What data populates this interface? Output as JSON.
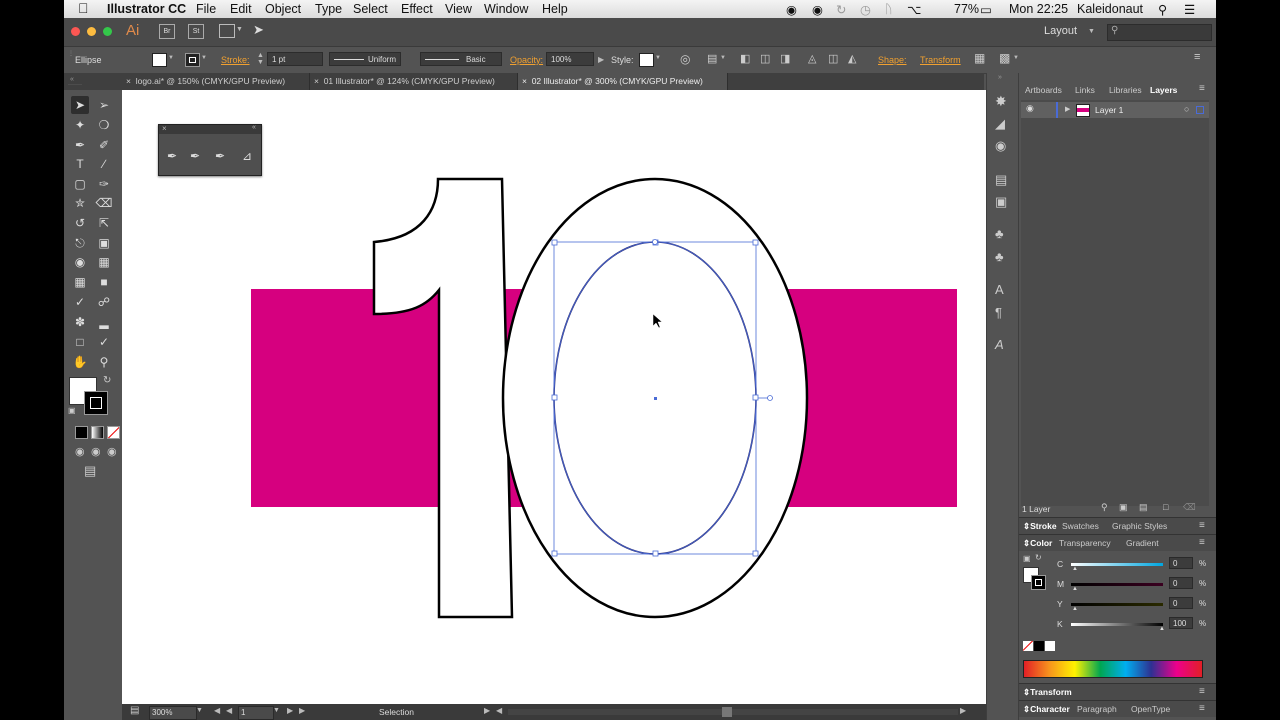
{
  "menubar": {
    "apple": "",
    "app_name": "Illustrator CC",
    "menus": [
      "File",
      "Edit",
      "Object",
      "Type",
      "Select",
      "Effect",
      "View",
      "Window",
      "Help"
    ],
    "battery": "77%",
    "clock": "Mon 22:25",
    "user": "Kaleidonaut"
  },
  "appbar": {
    "logo": "Ai",
    "btn_br": "Br",
    "btn_st": "St",
    "workspace": "Layout",
    "search_placeholder": ""
  },
  "control": {
    "selection_type": "Ellipse",
    "stroke_label": "Stroke:",
    "stroke_weight": "1 pt",
    "profile": "Uniform",
    "brush": "Basic",
    "opacity_label": "Opacity:",
    "opacity_value": "100%",
    "style_label": "Style:",
    "shape_label": "Shape:",
    "transform_label": "Transform"
  },
  "tabs": [
    {
      "label": "logo.ai* @ 150% (CMYK/GPU Preview)"
    },
    {
      "label": "01 Illustrator* @ 124% (CMYK/GPU Preview)"
    },
    {
      "label": "02 Illustrator* @ 300% (CMYK/GPU Preview)"
    }
  ],
  "statusbar": {
    "zoom": "300%",
    "artboard": "1",
    "tool": "Selection"
  },
  "panels": {
    "top_tabs": [
      "Artboards",
      "Links",
      "Libraries",
      "Layers"
    ],
    "layer_name": "Layer 1",
    "layer_count": "1 Layer",
    "stroke_tabs": [
      "Stroke",
      "Swatches",
      "Graphic Styles"
    ],
    "color_tabs": [
      "Color",
      "Transparency",
      "Gradient"
    ],
    "channels": [
      {
        "name": "C",
        "value": "0"
      },
      {
        "name": "M",
        "value": "0"
      },
      {
        "name": "Y",
        "value": "0"
      },
      {
        "name": "K",
        "value": "100"
      }
    ],
    "percent": "%",
    "transform_tab": "Transform",
    "char_tabs": [
      "Character",
      "Paragraph",
      "OpenType"
    ]
  },
  "colors": {
    "magenta": "#d6007f",
    "selection": "#4a6bd6"
  }
}
